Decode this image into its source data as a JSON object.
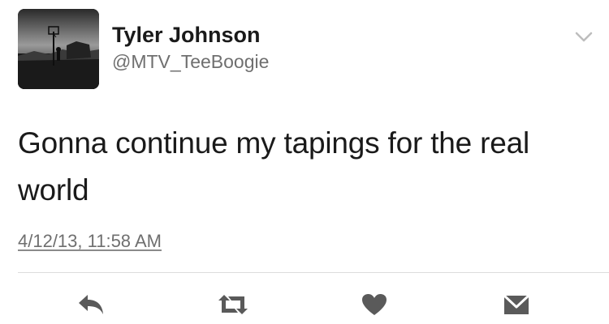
{
  "tweet": {
    "author": {
      "display_name": "Tyler Johnson",
      "handle": "@MTV_TeeBoogie"
    },
    "text": "Gonna continue my tapings for the real world",
    "timestamp": "4/12/13, 11:58 AM"
  },
  "icons": {
    "menu": "chevron-down-icon",
    "reply": "reply-icon",
    "retweet": "retweet-icon",
    "like": "heart-icon",
    "direct_message": "envelope-icon"
  },
  "colors": {
    "text": "#1a1a1a",
    "secondary_text": "#6f6f6f",
    "icon": "#5a5a5a",
    "divider": "#dcdcdc"
  }
}
